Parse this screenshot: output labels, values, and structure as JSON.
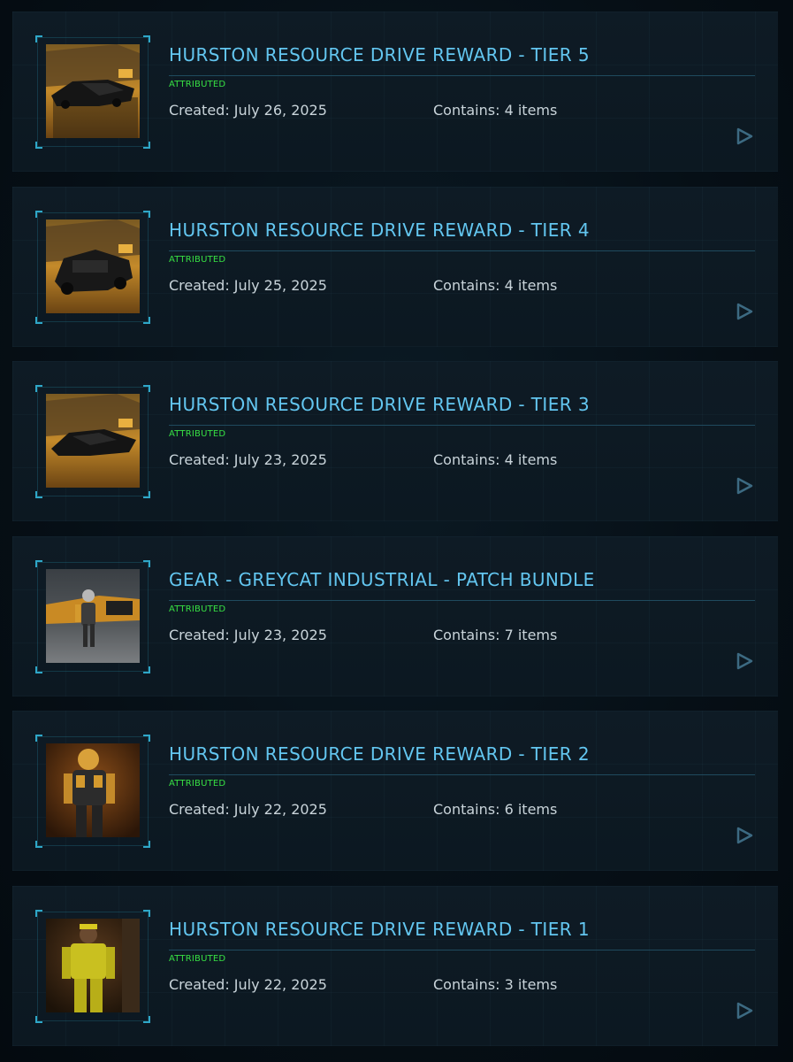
{
  "colors": {
    "title": "#63c6f0",
    "badge": "#37e043",
    "text": "#c9d4da",
    "accent": "#2fa7c8",
    "card_bg": "#0e1b25",
    "page_bg": "#050d13"
  },
  "items": [
    {
      "title": "HURSTON RESOURCE DRIVE REWARD - TIER 5",
      "badge": "ATTRIBUTED",
      "created": "Created: July 26, 2025",
      "contains": "Contains: 4 items",
      "thumbnail": "vehicle-hangar-image",
      "arrow_icon": "play-arrow-icon"
    },
    {
      "title": "HURSTON RESOURCE DRIVE REWARD - TIER 4",
      "badge": "ATTRIBUTED",
      "created": "Created: July 25, 2025",
      "contains": "Contains: 4 items",
      "thumbnail": "vehicle-hangar-image",
      "arrow_icon": "play-arrow-icon"
    },
    {
      "title": "HURSTON RESOURCE DRIVE REWARD - TIER 3",
      "badge": "ATTRIBUTED",
      "created": "Created: July 23, 2025",
      "contains": "Contains: 4 items",
      "thumbnail": "vehicle-hangar-image",
      "arrow_icon": "play-arrow-icon"
    },
    {
      "title": "GEAR - GREYCAT INDUSTRIAL - PATCH BUNDLE",
      "badge": "ATTRIBUTED",
      "created": "Created: July 23, 2025",
      "contains": "Contains: 7 items",
      "thumbnail": "character-armor-image",
      "arrow_icon": "play-arrow-icon"
    },
    {
      "title": "HURSTON RESOURCE DRIVE REWARD - TIER 2",
      "badge": "ATTRIBUTED",
      "created": "Created: July 22, 2025",
      "contains": "Contains: 6 items",
      "thumbnail": "character-armor-image",
      "arrow_icon": "play-arrow-icon"
    },
    {
      "title": "HURSTON RESOURCE DRIVE REWARD - TIER 1",
      "badge": "ATTRIBUTED",
      "created": "Created: July 22, 2025",
      "contains": "Contains: 3 items",
      "thumbnail": "character-flightsuit-image",
      "arrow_icon": "play-arrow-icon"
    }
  ]
}
